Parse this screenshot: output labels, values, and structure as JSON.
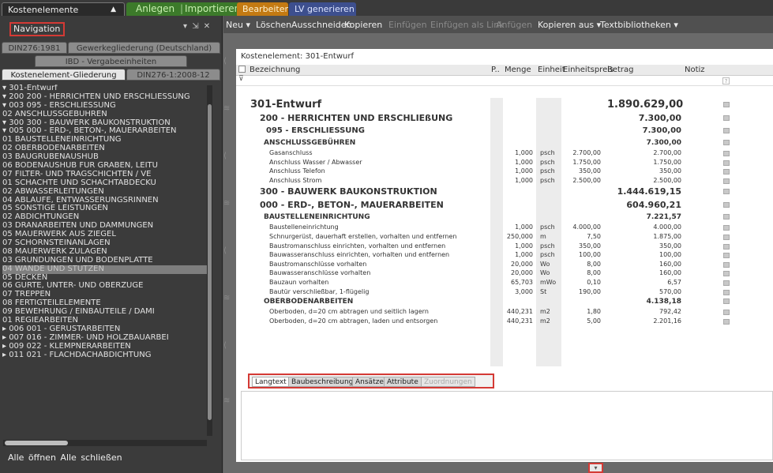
{
  "top_tabs": {
    "kostenelemente": "Kostenelemente",
    "anlegen": "Anlegen",
    "importieren": "Importieren",
    "bearbeiten": "Bearbeiten",
    "lv_generieren": "LV generieren"
  },
  "colors": {
    "anlegen": "#3c7a2a",
    "bearbeiten": "#c47a12",
    "lv_generieren": "#3d4f8e",
    "highlight_box": "#d43a35"
  },
  "navigation": {
    "title": "Navigation",
    "controls": "▾ ⇲ ✕",
    "filter_tabs": [
      "DIN276:1981",
      "Gewerkegliederung (Deutschland)",
      "IBD - Vergabeeinheiten",
      "Kostenelement-Gliederung",
      "DIN276-1:2008-12"
    ],
    "tree": [
      "▾ 301-Entwurf",
      "   ▾ 200 200 - HERRICHTEN UND ERSCHLIESSUNG",
      "      ▾ 003 095 - ERSCHLIESSUNG",
      "            02 ANSCHLUSSGEBÜHREN",
      "   ▾ 300 300 - BAUWERK BAUKONSTRUKTION",
      "      ▾ 005 000 - ERD-, BETON-, MAUERARBEITEN",
      "            01 BAUSTELLENEINRICHTUNG",
      "            02 OBERBODENARBEITEN",
      "            03 BAUGRUBENAUSHUB",
      "            06 BODENAUSHUB FÜR GRÄBEN, LEITU",
      "            07 FILTER- UND TRAGSCHICHTEN / VE",
      "            01 SCHÄCHTE UND SCHACHTABDECKU",
      "            02 ABWASSERLEITUNGEN",
      "            04 ABLÄUFE, ENTWÄSSERUNGSRINNEN",
      "            05 SONSTIGE LEISTUNGEN",
      "            02 ABDICHTUNGEN",
      "            03 DRÄNARBEITEN UND DÄMMUNGEN",
      "            05 MAUERWERK AUS ZIEGEL",
      "            07 SCHORNSTEINANLAGEN",
      "            08 MAUERWERK ZULAGEN",
      "            03 GRÜNDUNGEN UND BODENPLATTE",
      "            04 WÄNDE UND STÜTZEN",
      "            05 DECKEN",
      "            06 GURTE, UNTER- UND OBERZÜGE",
      "            07 TREPPEN",
      "            08 FERTIGTEILELEMENTE",
      "            09 BEWEHRUNG / EINBAUTEILE / DÄMI",
      "            01 REGIEARBEITEN",
      "      ▸ 006 001 - GERÜSTARBEITEN",
      "      ▸ 007 016 - ZIMMER- UND HOLZBAUARBEI",
      "      ▸ 009 022 - KLEMPNERARBEITEN",
      "      ▸ 011 021 - FLACHDACHABDICHTUNG"
    ],
    "footer": "Alle öffnen   Alle schließen"
  },
  "toolbar": {
    "items": [
      "Neu ▾",
      "Löschen",
      "Ausschneiden",
      "Kopieren",
      "Einfügen",
      "Einfügen als Link",
      "Anfügen",
      "Kopieren aus ▾",
      "Textbibliotheken ▾"
    ]
  },
  "grid": {
    "title": "Kostenelement: 301-Entwurf",
    "headers": [
      "Bezeichnung",
      "P..",
      "Menge",
      "Einheit",
      "Einheitspreis",
      "Betrag",
      "Notiz"
    ],
    "filter_hint": "?",
    "rows": [
      {
        "b": "301-Entwurf",
        "m": "",
        "e": "",
        "ep": "",
        "bt": "1.890.629,00"
      },
      {
        "b": "200 - HERRICHTEN UND ERSCHLIEßUNG",
        "m": "",
        "e": "",
        "ep": "",
        "bt": "7.300,00"
      },
      {
        "b": "095 - ERSCHLIESSUNG",
        "m": "",
        "e": "",
        "ep": "",
        "bt": "7.300,00"
      },
      {
        "b": "ANSCHLUSSGEBÜHREN",
        "m": "",
        "e": "",
        "ep": "",
        "bt": "7.300,00"
      },
      {
        "b": "Gasanschluss",
        "m": "1,000",
        "e": "psch",
        "ep": "2.700,00",
        "bt": "2.700,00"
      },
      {
        "b": "Anschluss Wasser / Abwasser",
        "m": "1,000",
        "e": "psch",
        "ep": "1.750,00",
        "bt": "1.750,00"
      },
      {
        "b": "Anschluss Telefon",
        "m": "1,000",
        "e": "psch",
        "ep": "350,00",
        "bt": "350,00"
      },
      {
        "b": "Anschluss Strom",
        "m": "1,000",
        "e": "psch",
        "ep": "2.500,00",
        "bt": "2.500,00"
      },
      {
        "b": "300 - BAUWERK BAUKONSTRUKTION",
        "m": "",
        "e": "",
        "ep": "",
        "bt": "1.444.619,15"
      },
      {
        "b": "000 - ERD-, BETON-, MAUERARBEITEN",
        "m": "",
        "e": "",
        "ep": "",
        "bt": "604.960,21"
      },
      {
        "b": "BAUSTELLENEINRICHTUNG",
        "m": "",
        "e": "",
        "ep": "",
        "bt": "7.221,57"
      },
      {
        "b": "Baustelleneinrichtung",
        "m": "1,000",
        "e": "psch",
        "ep": "4.000,00",
        "bt": "4.000,00"
      },
      {
        "b": "Schnurgerüst, dauerhaft erstellen, vorhalten und entfernen",
        "m": "250,000",
        "e": "m",
        "ep": "7,50",
        "bt": "1.875,00"
      },
      {
        "b": "Baustromanschluss einrichten, vorhalten und entfernen",
        "m": "1,000",
        "e": "psch",
        "ep": "350,00",
        "bt": "350,00"
      },
      {
        "b": "Bauwasseranschluss einrichten, vorhalten und entfernen",
        "m": "1,000",
        "e": "psch",
        "ep": "100,00",
        "bt": "100,00"
      },
      {
        "b": "Baustromanschlüsse vorhalten",
        "m": "20,000",
        "e": "Wo",
        "ep": "8,00",
        "bt": "160,00"
      },
      {
        "b": "Bauwasseranschlüsse vorhalten",
        "m": "20,000",
        "e": "Wo",
        "ep": "8,00",
        "bt": "160,00"
      },
      {
        "b": "Bauzaun vorhalten",
        "m": "65,703",
        "e": "mWo",
        "ep": "0,10",
        "bt": "6,57"
      },
      {
        "b": "Bautür verschließbar, 1-flügelig",
        "m": "3,000",
        "e": "St",
        "ep": "190,00",
        "bt": "570,00"
      },
      {
        "b": "OBERBODENARBEITEN",
        "m": "",
        "e": "",
        "ep": "",
        "bt": "4.138,18"
      },
      {
        "b": "Oberboden, d=20 cm abtragen und seitlich lagern",
        "m": "440,231",
        "e": "m2",
        "ep": "1,80",
        "bt": "792,42"
      },
      {
        "b": "Oberboden, d=20 cm abtragen, laden und entsorgen",
        "m": "440,231",
        "e": "m2",
        "ep": "5,00",
        "bt": "2.201,16"
      }
    ]
  },
  "detail": {
    "tabs": [
      "Langtext",
      "Baubeschreibung",
      "Ansätze",
      "Attribute",
      "Zuordnungen"
    ]
  }
}
